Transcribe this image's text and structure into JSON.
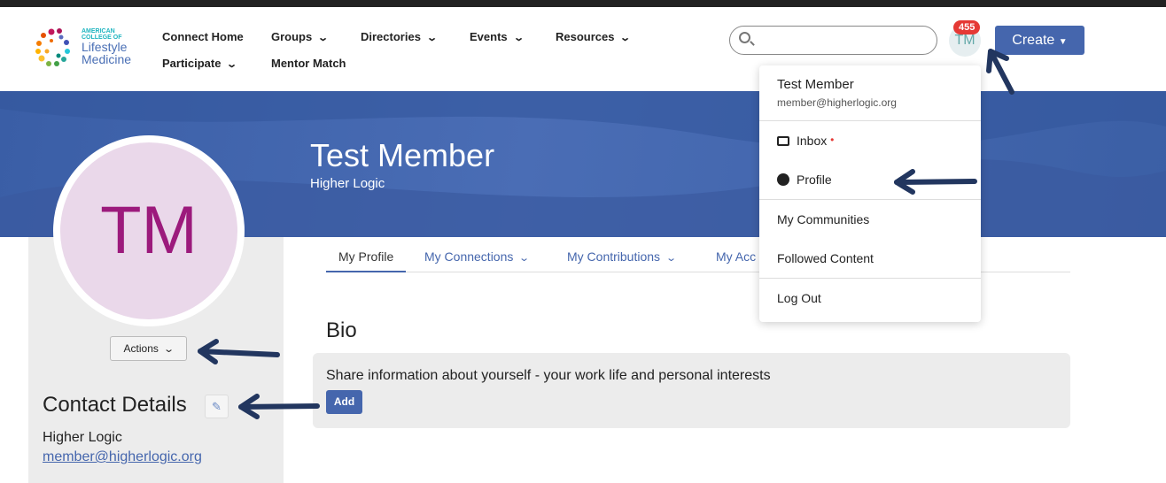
{
  "logo": {
    "line1": "AMERICAN",
    "line2": "COLLEGE OF",
    "line3": "Lifestyle",
    "line4": "Medicine"
  },
  "nav": {
    "connect_home": "Connect Home",
    "groups": "Groups",
    "directories": "Directories",
    "events": "Events",
    "resources": "Resources",
    "participate": "Participate",
    "mentor_match": "Mentor Match"
  },
  "header": {
    "search_placeholder": "",
    "avatar_initials": "TM",
    "notification_count": "455",
    "create_label": "Create"
  },
  "profile": {
    "name": "Test Member",
    "org": "Higher Logic",
    "initials": "TM",
    "actions_label": "Actions"
  },
  "contact": {
    "title": "Contact Details",
    "name": "Higher Logic",
    "email": "member@higherlogic.org"
  },
  "tabs": [
    "My Profile",
    "My Connections",
    "My Contributions",
    "My Acc"
  ],
  "bio": {
    "title": "Bio",
    "prompt": "Share information about yourself - your work life and personal interests",
    "add_label": "Add"
  },
  "dropdown": {
    "name": "Test Member",
    "email": "member@higherlogic.org",
    "inbox": "Inbox",
    "profile": "Profile",
    "communities": "My Communities",
    "followed": "Followed Content",
    "logout": "Log Out"
  },
  "colors": {
    "brand": "#4566ad",
    "badge": "#e53935",
    "arrow": "#22365f"
  }
}
